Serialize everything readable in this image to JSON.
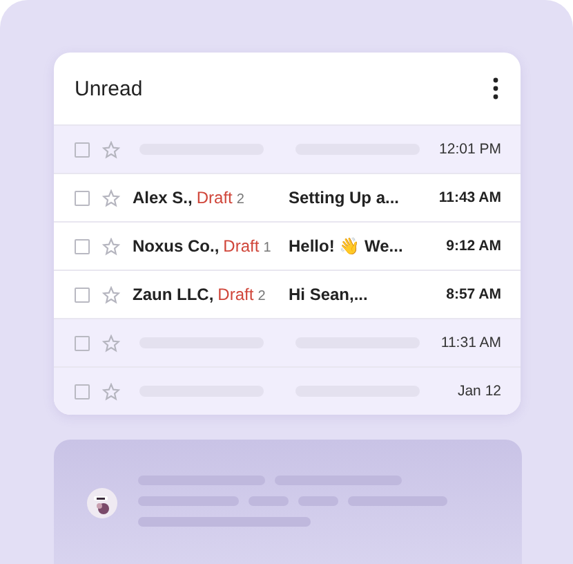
{
  "card": {
    "title": "Unread"
  },
  "rows": [
    {
      "kind": "placeholder",
      "checked": false,
      "starred": false,
      "time": "12:01 PM"
    },
    {
      "kind": "message",
      "checked": false,
      "starred": false,
      "sender": "Alex S.,",
      "draft": "Draft",
      "count": "2",
      "subject": "Setting Up a...",
      "time": "11:43 AM"
    },
    {
      "kind": "message",
      "checked": false,
      "starred": false,
      "sender": "Noxus Co.,",
      "draft": "Draft",
      "count": "1",
      "subject": "Hello! 👋 We...",
      "time": "9:12 AM"
    },
    {
      "kind": "message",
      "checked": false,
      "starred": false,
      "sender": "Zaun LLC,",
      "draft": "Draft",
      "count": "2",
      "subject": "Hi Sean,...",
      "time": "8:57 AM"
    },
    {
      "kind": "placeholder",
      "checked": false,
      "starred": false,
      "time": "11:31 AM"
    },
    {
      "kind": "placeholder",
      "checked": false,
      "starred": false,
      "time": "Jan 12"
    }
  ]
}
